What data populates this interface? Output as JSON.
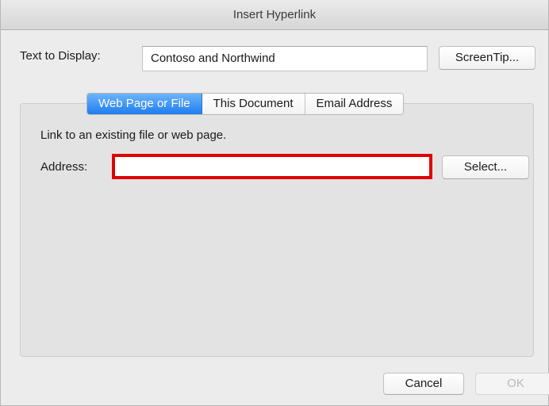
{
  "window": {
    "title": "Insert Hyperlink"
  },
  "text_to_display": {
    "label": "Text to Display:",
    "value": "Contoso and Northwind"
  },
  "screentip_button": {
    "label": "ScreenTip..."
  },
  "tabs": [
    {
      "label": "Web Page or File",
      "active": true
    },
    {
      "label": "This Document",
      "active": false
    },
    {
      "label": "Email Address",
      "active": false
    }
  ],
  "web_page_pane": {
    "instruction": "Link to an existing file or web page.",
    "address_label": "Address:",
    "address_value": "",
    "address_highlight_color": "#e00000",
    "select_button_label": "Select..."
  },
  "footer": {
    "cancel_label": "Cancel",
    "ok_label": "OK",
    "ok_enabled": false
  },
  "colors": {
    "active_tab": "#1f7ef0",
    "window_background": "#ececec"
  }
}
